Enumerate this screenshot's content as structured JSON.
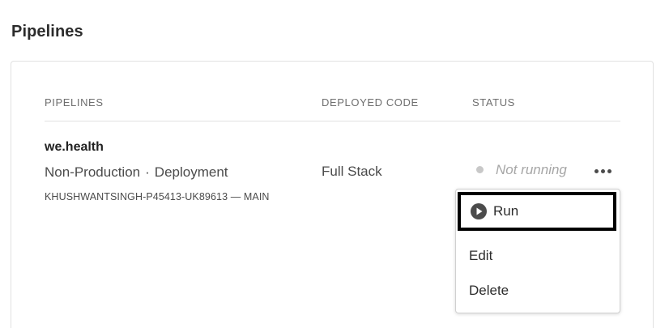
{
  "page_title": "Pipelines",
  "table": {
    "headers": {
      "pipelines": "PIPELINES",
      "deployed_code": "DEPLOYED CODE",
      "status": "STATUS"
    },
    "rows": [
      {
        "name": "we.health",
        "environment": "Non-Production",
        "separator": "·",
        "kind": "Deployment",
        "repo": "KHUSHWANTSINGH-P45413-UK89613 — MAIN",
        "deployed_code": "Full Stack",
        "status": "Not running",
        "more_icon": "more-horizontal-icon"
      }
    ]
  },
  "menu": {
    "items": [
      {
        "label": "Run",
        "icon": "play-icon"
      },
      {
        "label": "Edit"
      },
      {
        "label": "Delete"
      }
    ]
  },
  "colors": {
    "status_dot": "#c8c8c8",
    "run_highlight_border": "#000000",
    "play_icon": "#4b4b4b"
  }
}
